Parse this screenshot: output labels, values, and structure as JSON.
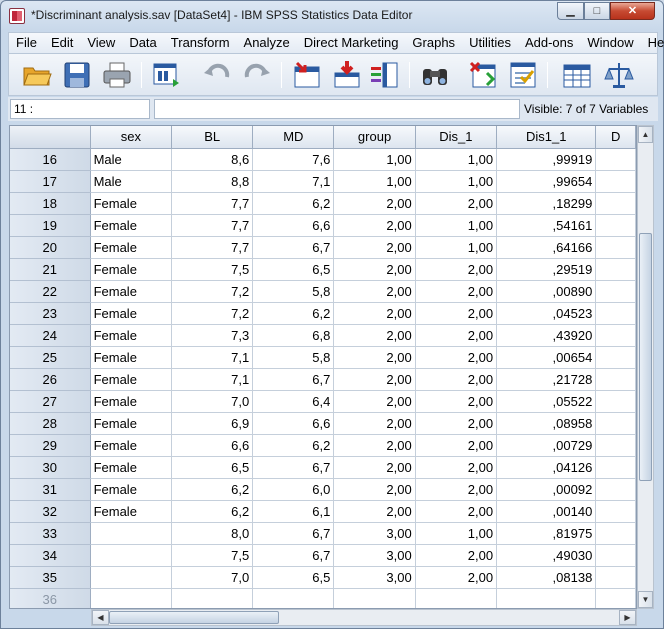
{
  "window": {
    "title": "*Discriminant analysis.sav [DataSet4] - IBM SPSS Statistics Data Editor",
    "minimize": "▁",
    "maximize": "□",
    "close": "✕"
  },
  "menu": [
    {
      "label": "File"
    },
    {
      "label": "Edit"
    },
    {
      "label": "View"
    },
    {
      "label": "Data"
    },
    {
      "label": "Transform"
    },
    {
      "label": "Analyze"
    },
    {
      "label": "Direct Marketing"
    },
    {
      "label": "Graphs"
    },
    {
      "label": "Utilities"
    },
    {
      "label": "Add-ons"
    },
    {
      "label": "Window"
    },
    {
      "label": "Help"
    }
  ],
  "toolbar": {
    "icons": [
      "open-folder-icon",
      "save-icon",
      "print-icon",
      "dialog-recall-icon",
      "undo-icon",
      "redo-icon",
      "go-to-case-icon",
      "insert-cases-icon",
      "insert-variable-icon",
      "find-icon",
      "split-file-icon",
      "select-cases-icon",
      "value-labels-icon",
      "weight-cases-icon"
    ]
  },
  "cellbar": {
    "cell_ref": "11 :",
    "cell_value": "",
    "visible": "Visible: 7 of 7 Variables"
  },
  "grid": {
    "columns": [
      "sex",
      "BL",
      "MD",
      "group",
      "Dis_1",
      "Dis1_1",
      "D"
    ],
    "rows": [
      {
        "n": "16",
        "cells": [
          "Male",
          "8,6",
          "7,6",
          "1,00",
          "1,00",
          ",99919",
          ""
        ]
      },
      {
        "n": "17",
        "cells": [
          "Male",
          "8,8",
          "7,1",
          "1,00",
          "1,00",
          ",99654",
          ""
        ]
      },
      {
        "n": "18",
        "cells": [
          "Female",
          "7,7",
          "6,2",
          "2,00",
          "2,00",
          ",18299",
          ""
        ]
      },
      {
        "n": "19",
        "cells": [
          "Female",
          "7,7",
          "6,6",
          "2,00",
          "1,00",
          ",54161",
          ""
        ]
      },
      {
        "n": "20",
        "cells": [
          "Female",
          "7,7",
          "6,7",
          "2,00",
          "1,00",
          ",64166",
          ""
        ]
      },
      {
        "n": "21",
        "cells": [
          "Female",
          "7,5",
          "6,5",
          "2,00",
          "2,00",
          ",29519",
          ""
        ]
      },
      {
        "n": "22",
        "cells": [
          "Female",
          "7,2",
          "5,8",
          "2,00",
          "2,00",
          ",00890",
          ""
        ]
      },
      {
        "n": "23",
        "cells": [
          "Female",
          "7,2",
          "6,2",
          "2,00",
          "2,00",
          ",04523",
          ""
        ]
      },
      {
        "n": "24",
        "cells": [
          "Female",
          "7,3",
          "6,8",
          "2,00",
          "2,00",
          ",43920",
          ""
        ]
      },
      {
        "n": "25",
        "cells": [
          "Female",
          "7,1",
          "5,8",
          "2,00",
          "2,00",
          ",00654",
          ""
        ]
      },
      {
        "n": "26",
        "cells": [
          "Female",
          "7,1",
          "6,7",
          "2,00",
          "2,00",
          ",21728",
          ""
        ]
      },
      {
        "n": "27",
        "cells": [
          "Female",
          "7,0",
          "6,4",
          "2,00",
          "2,00",
          ",05522",
          ""
        ]
      },
      {
        "n": "28",
        "cells": [
          "Female",
          "6,9",
          "6,6",
          "2,00",
          "2,00",
          ",08958",
          ""
        ]
      },
      {
        "n": "29",
        "cells": [
          "Female",
          "6,6",
          "6,2",
          "2,00",
          "2,00",
          ",00729",
          ""
        ]
      },
      {
        "n": "30",
        "cells": [
          "Female",
          "6,5",
          "6,7",
          "2,00",
          "2,00",
          ",04126",
          ""
        ]
      },
      {
        "n": "31",
        "cells": [
          "Female",
          "6,2",
          "6,0",
          "2,00",
          "2,00",
          ",00092",
          ""
        ]
      },
      {
        "n": "32",
        "cells": [
          "Female",
          "6,2",
          "6,1",
          "2,00",
          "2,00",
          ",00140",
          ""
        ]
      },
      {
        "n": "33",
        "cells": [
          "",
          "8,0",
          "6,7",
          "3,00",
          "1,00",
          ",81975",
          ""
        ]
      },
      {
        "n": "34",
        "cells": [
          "",
          "7,5",
          "6,7",
          "3,00",
          "2,00",
          ",49030",
          ""
        ]
      },
      {
        "n": "35",
        "cells": [
          "",
          "7,0",
          "6,5",
          "3,00",
          "2,00",
          ",08138",
          ""
        ]
      },
      {
        "n": "36",
        "cells": [
          "",
          "",
          "",
          "",
          "",
          "",
          ""
        ],
        "empty": true
      }
    ]
  },
  "scroll": {
    "up": "▲",
    "down": "▼",
    "left": "◀",
    "right": "▶",
    "vertical_position": 0.45,
    "horizontal_position": 0.0
  }
}
